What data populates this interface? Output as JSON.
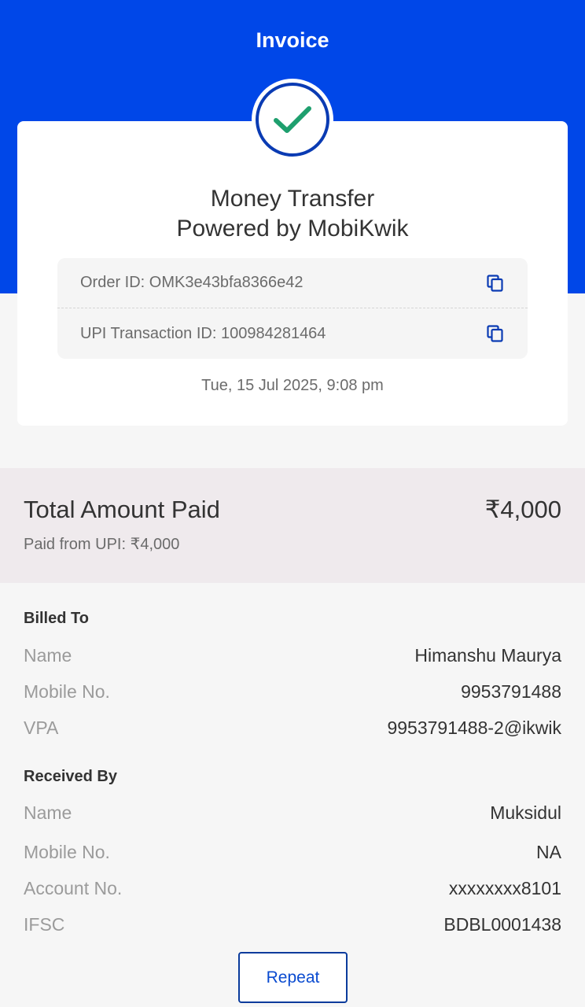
{
  "header": {
    "title": "Invoice"
  },
  "card": {
    "title_line1": "Money Transfer",
    "title_line2": "Powered by MobiKwik",
    "order_id": "Order ID: OMK3e43bfa8366e42",
    "upi_txn_id": "UPI Transaction ID: 100984281464",
    "datetime": "Tue, 15 Jul 2025, 9:08 pm"
  },
  "total": {
    "label": "Total Amount Paid",
    "amount": "₹4,000",
    "paid_from": "Paid from UPI: ₹4,000"
  },
  "billed_to": {
    "title": "Billed To",
    "rows": [
      {
        "label": "Name",
        "value": "Himanshu Maurya"
      },
      {
        "label": "Mobile No.",
        "value": "9953791488"
      },
      {
        "label": "VPA",
        "value": "9953791488-2@ikwik"
      }
    ]
  },
  "received_by": {
    "title": "Received By",
    "rows": [
      {
        "label": "Name",
        "value": "Muksidul"
      },
      {
        "label": "Mobile No.",
        "value": "NA"
      },
      {
        "label": "Account No.",
        "value": "xxxxxxxx8101"
      },
      {
        "label": "IFSC",
        "value": "BDBL0001438"
      }
    ]
  },
  "actions": {
    "repeat_label": "Repeat"
  },
  "colors": {
    "header_blue": "#0047e8",
    "check_green": "#1e9f6e",
    "accent_blue": "#0a4bd0"
  },
  "icons": [
    "check-icon",
    "copy-icon"
  ]
}
